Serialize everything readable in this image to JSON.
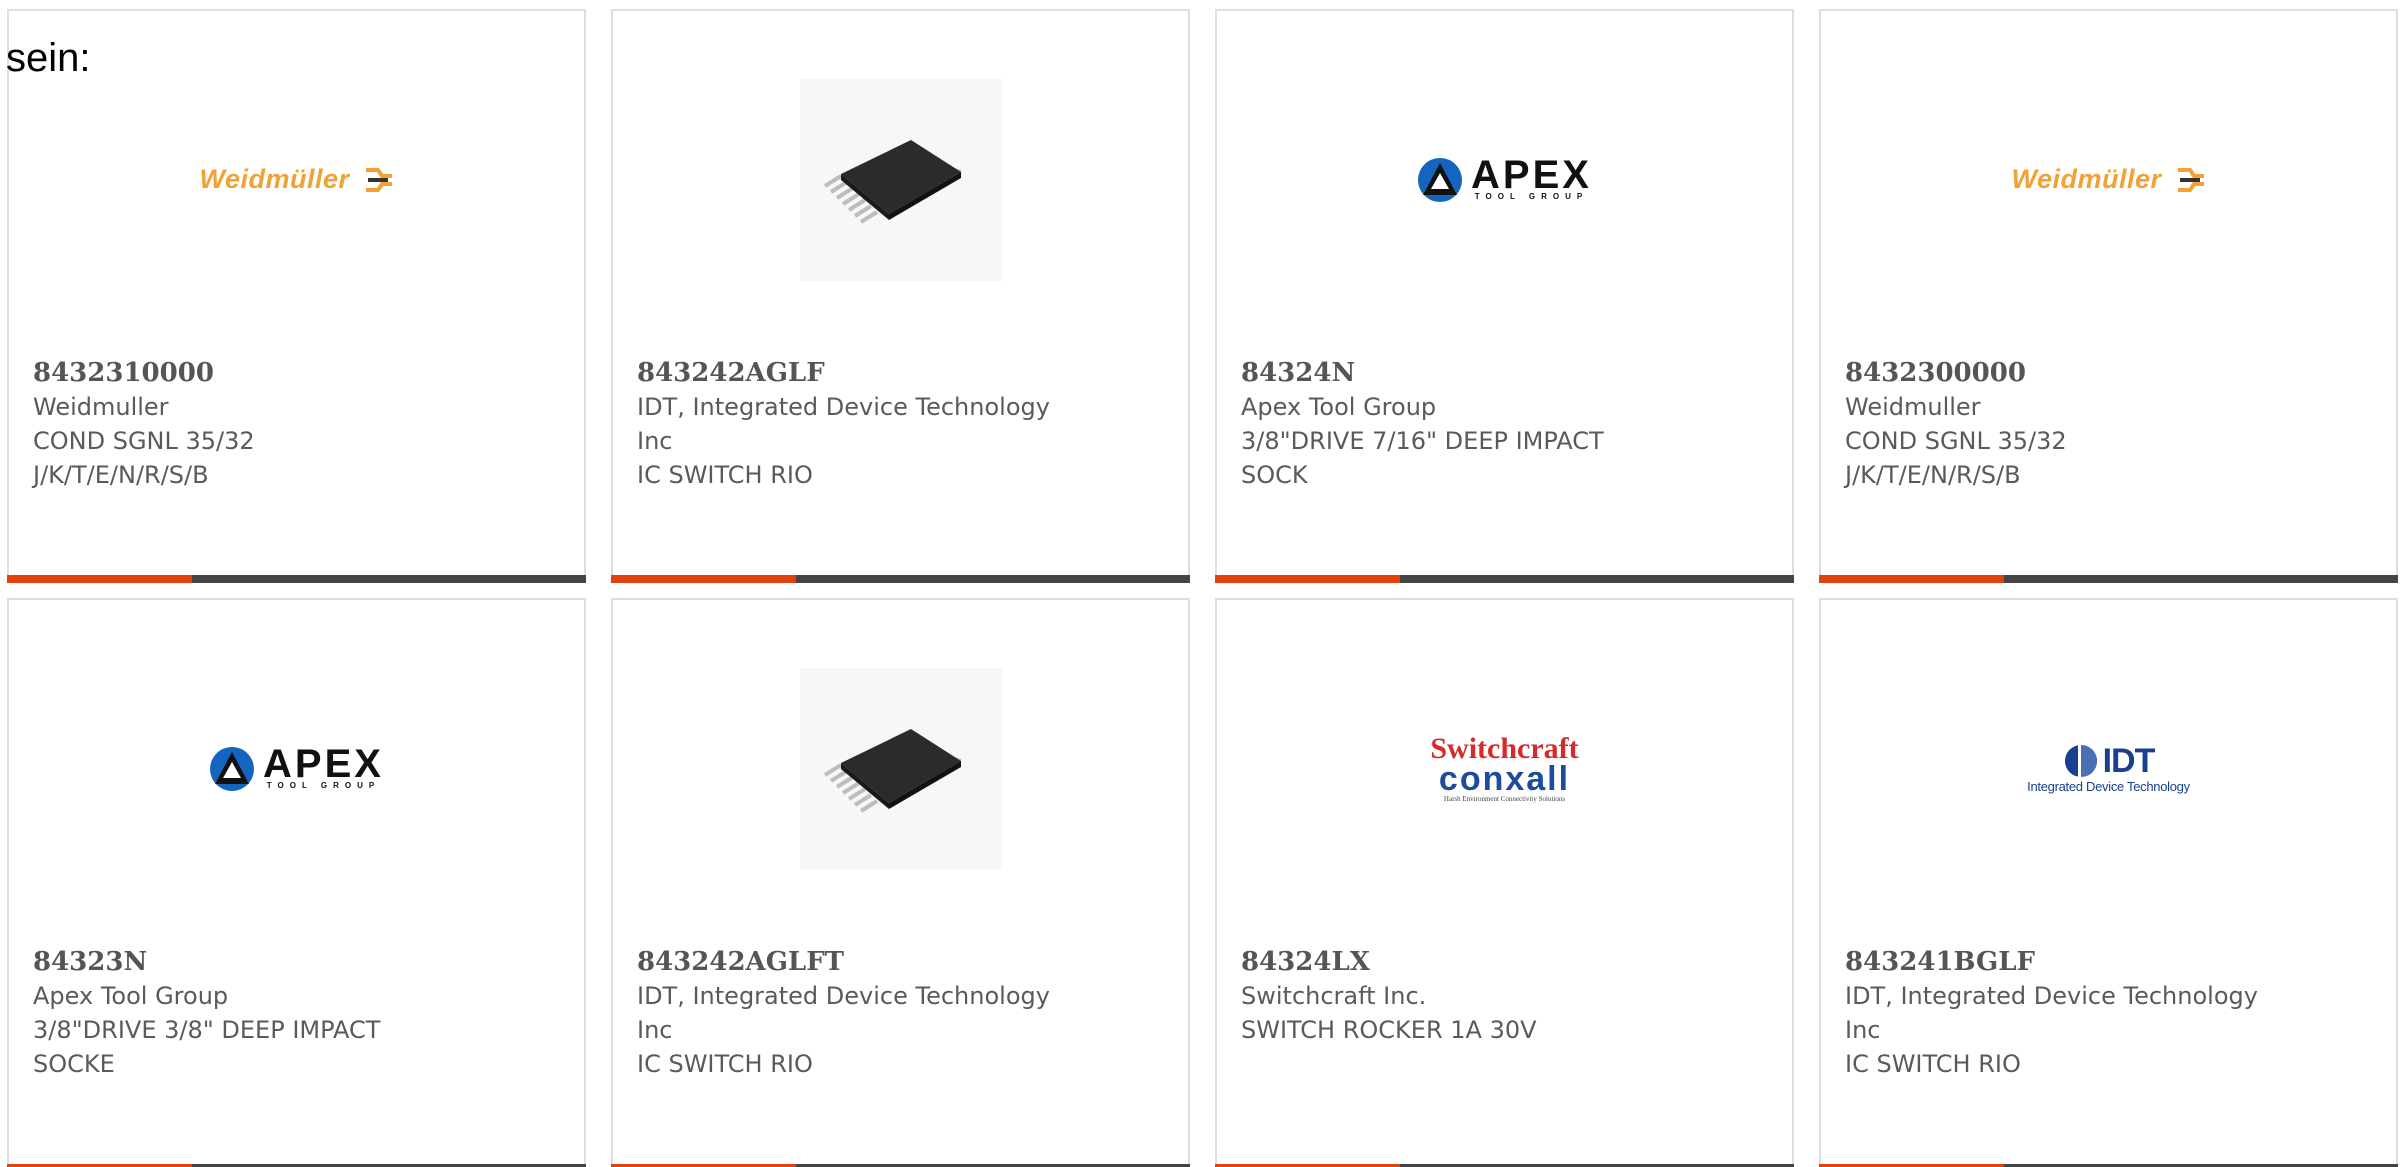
{
  "intro_text": "sein:",
  "colors": {
    "accent_bar": "#e2400c",
    "bar_dark": "#444444",
    "card_border": "#dedede",
    "text": "#5a5a5a"
  },
  "cards": [
    {
      "part_number": "8432310000",
      "manufacturer": "Weidmuller",
      "description": "COND SGNL 35/32 J/K/T/E/N/R/S/B",
      "image": {
        "kind": "logo-weidmuller",
        "text": "Weidmüller"
      }
    },
    {
      "part_number": "843242AGLF",
      "manufacturer": "IDT, Integrated Device Technology Inc",
      "description": "IC SWITCH RIO",
      "image": {
        "kind": "ic-chip-photo"
      }
    },
    {
      "part_number": "84324N",
      "manufacturer": "Apex Tool Group",
      "description": "3/8\"DRIVE 7/16\" DEEP IMPACT SOCK",
      "image": {
        "kind": "logo-apex",
        "text": "APEX",
        "subtext": "TOOL GROUP"
      }
    },
    {
      "part_number": "8432300000",
      "manufacturer": "Weidmuller",
      "description": "COND SGNL 35/32 J/K/T/E/N/R/S/B",
      "image": {
        "kind": "logo-weidmuller",
        "text": "Weidmüller"
      }
    },
    {
      "part_number": "84323N",
      "manufacturer": "Apex Tool Group",
      "description": "3/8\"DRIVE 3/8\" DEEP IMPACT SOCKE",
      "image": {
        "kind": "logo-apex",
        "text": "APEX",
        "subtext": "TOOL GROUP"
      }
    },
    {
      "part_number": "843242AGLFT",
      "manufacturer": "IDT, Integrated Device Technology Inc",
      "description": "IC SWITCH RIO",
      "image": {
        "kind": "ic-chip-photo"
      }
    },
    {
      "part_number": "84324LX",
      "manufacturer": "Switchcraft Inc.",
      "description": "SWITCH ROCKER 1A 30V",
      "image": {
        "kind": "logo-switchcraft",
        "text_top": "Switchcraft",
        "text_bottom": "conxall",
        "tagline": "Harsh Environment Connectivity Solutions"
      }
    },
    {
      "part_number": "843241BGLF",
      "manufacturer": "IDT, Integrated Device Technology Inc",
      "description": "IC SWITCH RIO",
      "image": {
        "kind": "logo-idt",
        "text": "IDT",
        "subtext": "Integrated Device Technology"
      }
    }
  ]
}
